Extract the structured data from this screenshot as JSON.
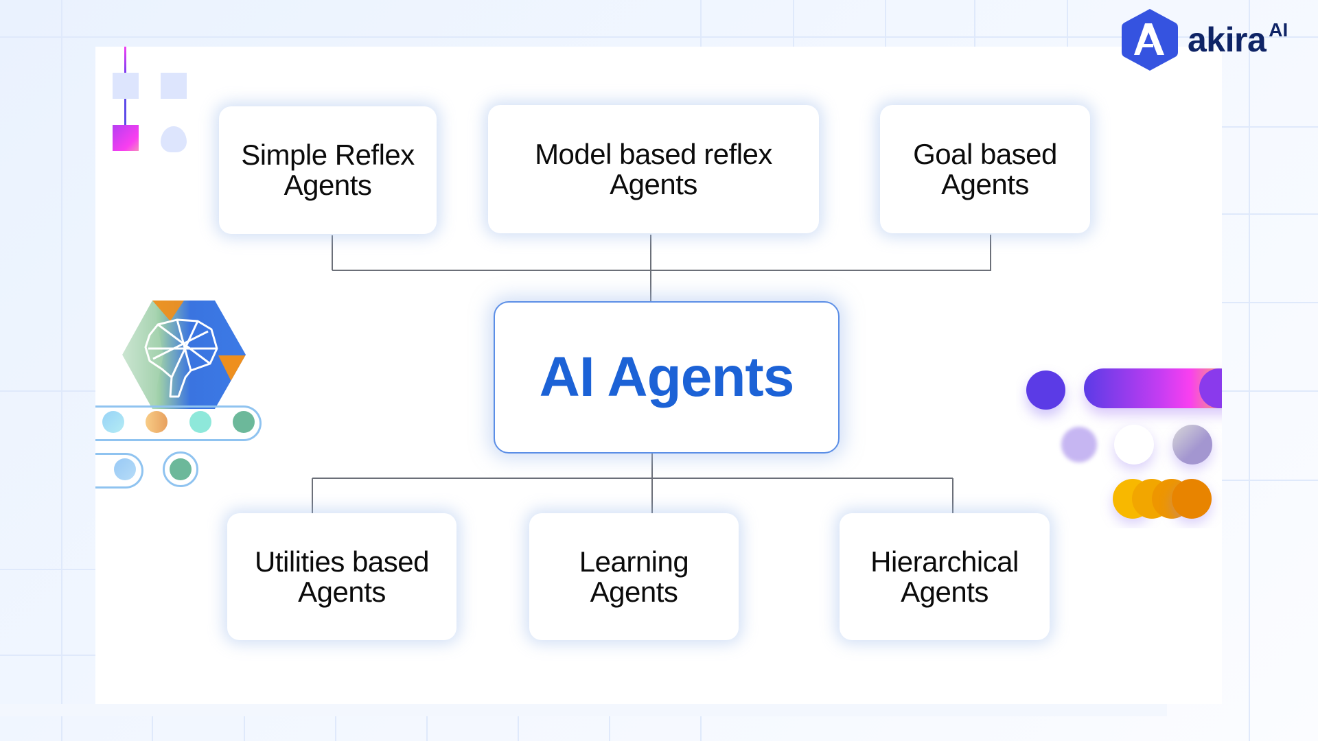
{
  "brand": {
    "name": "akira",
    "superscript": "AI",
    "logo_icon": "hexagon-a-logo-icon",
    "colors": {
      "logo_hex": "#3553e0",
      "wordmark": "#0f2466"
    }
  },
  "diagram": {
    "title": "AI Agents",
    "root": {
      "label": "AI Agents",
      "color": "#1c62d6",
      "border": "#5b8ee6"
    },
    "top_row": [
      {
        "line1": "Simple Reflex",
        "line2": "Agents"
      },
      {
        "line1": "Model based reflex",
        "line2": "Agents"
      },
      {
        "line1": "Goal based",
        "line2": "Agents"
      }
    ],
    "bottom_row": [
      {
        "line1": "Utilities based",
        "line2": "Agents"
      },
      {
        "line1": "Learning",
        "line2": "Agents"
      },
      {
        "line1": "Hierarchical",
        "line2": "Agents"
      }
    ],
    "edges": [
      {
        "from": "AI Agents",
        "to": "Simple Reflex Agents"
      },
      {
        "from": "AI Agents",
        "to": "Model based reflex Agents"
      },
      {
        "from": "AI Agents",
        "to": "Goal based Agents"
      },
      {
        "from": "AI Agents",
        "to": "Utilities based Agents"
      },
      {
        "from": "AI Agents",
        "to": "Learning Agents"
      },
      {
        "from": "AI Agents",
        "to": "Hierarchical Agents"
      }
    ],
    "connector_color": "#6b6f78"
  },
  "decorations": {
    "left_top_icon": "blocks-flow-icon",
    "left_mid_icon": "brain-hexagon-icon",
    "left_dots": [
      "#a7ddf5",
      "#f0b06e",
      "#8ee8da",
      "#6cb89a"
    ],
    "left_ring_dots": [
      "#a3d2f5",
      "#6cb89a"
    ],
    "right_icon": "color-palette-icon",
    "right_colors": {
      "purple_dot": "#5b3be6",
      "gradient_bar": [
        "#5b3be6",
        "#c43df2",
        "#f43ff0",
        "#f0c34a"
      ],
      "soft_dots": [
        "#c6b6f2",
        "#ffffff",
        "#a89bd0"
      ],
      "orange_dots": [
        "#f8b800",
        "#f2a600",
        "#ee9600",
        "#e88400"
      ]
    }
  }
}
